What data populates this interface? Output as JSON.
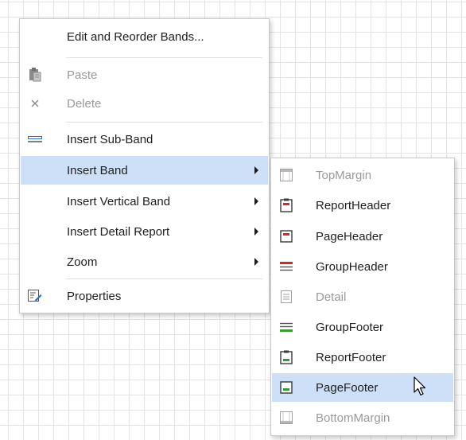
{
  "main_menu": {
    "items": [
      {
        "label": "Edit and Reorder Bands...",
        "icon": null,
        "disabled": false,
        "submenu": false
      },
      {
        "label": "Paste",
        "icon": "paste-icon",
        "disabled": true,
        "submenu": false
      },
      {
        "label": "Delete",
        "icon": "delete-icon",
        "disabled": true,
        "submenu": false
      },
      {
        "label": "Insert Sub-Band",
        "icon": "sub-band-icon",
        "disabled": false,
        "submenu": false
      },
      {
        "label": "Insert Band",
        "icon": null,
        "disabled": false,
        "submenu": true,
        "active": true
      },
      {
        "label": "Insert Vertical Band",
        "icon": null,
        "disabled": false,
        "submenu": true
      },
      {
        "label": "Insert Detail Report",
        "icon": null,
        "disabled": false,
        "submenu": true
      },
      {
        "label": "Zoom",
        "icon": null,
        "disabled": false,
        "submenu": true
      },
      {
        "label": "Properties",
        "icon": "properties-icon",
        "disabled": false,
        "submenu": false
      }
    ]
  },
  "sub_menu": {
    "items": [
      {
        "label": "TopMargin",
        "icon": "top-margin-icon",
        "disabled": true
      },
      {
        "label": "ReportHeader",
        "icon": "report-header-icon",
        "disabled": false
      },
      {
        "label": "PageHeader",
        "icon": "page-header-icon",
        "disabled": false
      },
      {
        "label": "GroupHeader",
        "icon": "group-header-icon",
        "disabled": false
      },
      {
        "label": "Detail",
        "icon": "detail-icon",
        "disabled": true
      },
      {
        "label": "GroupFooter",
        "icon": "group-footer-icon",
        "disabled": false
      },
      {
        "label": "ReportFooter",
        "icon": "report-footer-icon",
        "disabled": false
      },
      {
        "label": "PageFooter",
        "icon": "page-footer-icon",
        "disabled": false,
        "hovered": true
      },
      {
        "label": "BottomMargin",
        "icon": "bottom-margin-icon",
        "disabled": true
      }
    ]
  },
  "colors": {
    "highlight": "#cde0f7",
    "band_red": "#d9252a",
    "band_green": "#3a9a3a",
    "band_blue": "#2d6fbf"
  }
}
